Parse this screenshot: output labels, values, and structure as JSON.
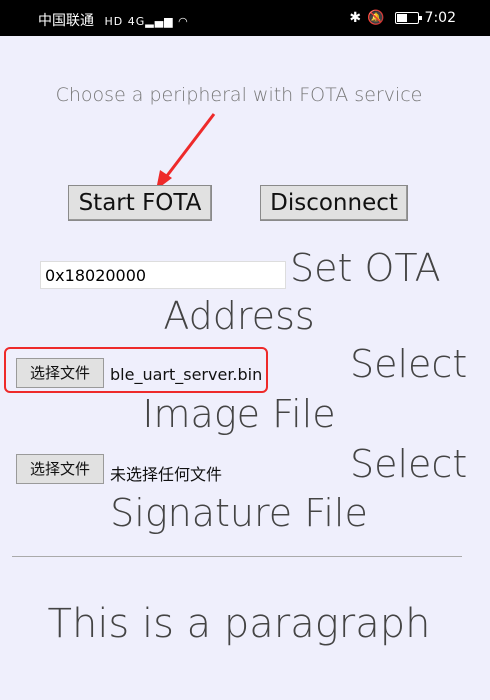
{
  "status_bar": {
    "carrier": "中国联通",
    "network": "4G",
    "time": "7:02"
  },
  "subtitle": "Choose a peripheral with FOTA service",
  "buttons": {
    "start_fota": "Start FOTA",
    "disconnect": "Disconnect"
  },
  "ota": {
    "address_value": "0x18020000",
    "label_line1": "Set OTA",
    "label_line2": "Address"
  },
  "image_file": {
    "button": "选择文件",
    "filename": "ble_uart_server.bin",
    "label_line1": "Select",
    "label_line2": "Image File"
  },
  "signature_file": {
    "button": "选择文件",
    "filename": "未选择任何文件",
    "label_line1": "Select",
    "label_line2": "Signature File"
  },
  "paragraph": "This is a paragraph",
  "colors": {
    "annotation_red": "#ee2a2a",
    "page_bg": "#efeffc",
    "status_bg": "#000000"
  }
}
